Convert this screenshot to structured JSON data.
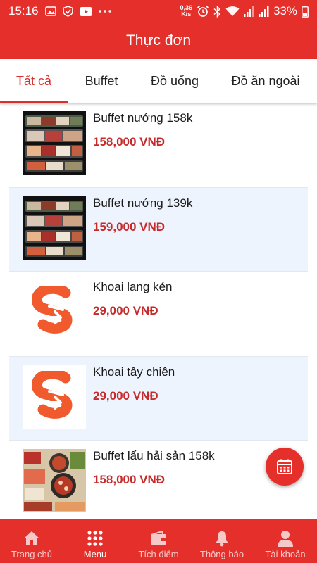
{
  "status_bar": {
    "time": "15:16",
    "net_speed_value": "0,36",
    "net_speed_unit": "K/s",
    "battery": "33%",
    "icons": [
      "image-icon",
      "shield-icon",
      "youtube-icon",
      "more-icon",
      "alarm-icon",
      "bluetooth-icon",
      "wifi-icon",
      "signal-icon",
      "signal-icon",
      "battery-icon"
    ]
  },
  "header": {
    "title": "Thực đơn"
  },
  "tabs": [
    {
      "label": "Tất cả",
      "active": true
    },
    {
      "label": "Buffet",
      "active": false
    },
    {
      "label": "Đồ uống",
      "active": false
    },
    {
      "label": "Đồ ăn ngoài",
      "active": false
    }
  ],
  "menu_items": [
    {
      "name": "Buffet nướng 158k",
      "price": "158,000 VNĐ",
      "image": "bbq-platter"
    },
    {
      "name": "Buffet nướng 139k",
      "price": "159,000 VNĐ",
      "image": "bbq-platter"
    },
    {
      "name": "Khoai lang kén",
      "price": "29,000 VNĐ",
      "image": "brand-logo"
    },
    {
      "name": "Khoai tây chiên",
      "price": "29,000 VNĐ",
      "image": "brand-logo"
    },
    {
      "name": "Buffet lẩu hải sản 158k",
      "price": "158,000 VNĐ",
      "image": "seafood-hotpot"
    }
  ],
  "fab": {
    "icon": "calendar-icon"
  },
  "bottom_nav": [
    {
      "label": "Trang chủ",
      "icon": "home-icon",
      "active": false
    },
    {
      "label": "Menu",
      "icon": "grid-icon",
      "active": true
    },
    {
      "label": "Tích điểm",
      "icon": "wallet-icon",
      "active": false
    },
    {
      "label": "Thông báo",
      "icon": "bell-icon",
      "active": false
    },
    {
      "label": "Tài khoản",
      "icon": "user-icon",
      "active": false
    }
  ],
  "colors": {
    "primary": "#e42f2b",
    "price": "#c62a2a",
    "alt_row": "#eef4fd"
  }
}
